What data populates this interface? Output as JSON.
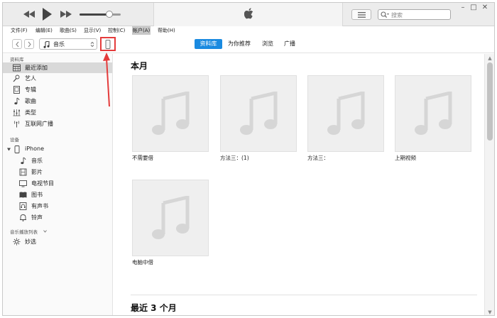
{
  "menu": [
    "文件(F)",
    "编辑(E)",
    "歌曲(S)",
    "显示(V)",
    "控制(C)",
    "帐户(A)",
    "帮助(H)"
  ],
  "menu_active_index": 5,
  "search": {
    "placeholder": "搜索"
  },
  "toolbar": {
    "media_select": "音乐"
  },
  "tabs": [
    "资料库",
    "为你推荐",
    "浏览",
    "广播"
  ],
  "tab_active_index": 0,
  "sidebar": {
    "library_header": "资料库",
    "library_items": [
      {
        "label": "最近添加",
        "icon": "recently-added-icon",
        "selected": true
      },
      {
        "label": "艺人",
        "icon": "artist-icon",
        "selected": false
      },
      {
        "label": "专辑",
        "icon": "album-icon",
        "selected": false
      },
      {
        "label": "歌曲",
        "icon": "song-icon",
        "selected": false
      },
      {
        "label": "类型",
        "icon": "genre-icon",
        "selected": false
      },
      {
        "label": "互联网广播",
        "icon": "internet-radio-icon",
        "selected": false
      }
    ],
    "devices_header": "设备",
    "device": {
      "name": "iPhone"
    },
    "device_items": [
      {
        "label": "音乐",
        "icon": "music-icon"
      },
      {
        "label": "影片",
        "icon": "film-icon"
      },
      {
        "label": "电视节目",
        "icon": "tv-icon"
      },
      {
        "label": "图书",
        "icon": "book-icon"
      },
      {
        "label": "有声书",
        "icon": "audiobook-icon"
      },
      {
        "label": "铃声",
        "icon": "bell-icon"
      }
    ],
    "playlists_header": "音乐播放列表",
    "playlist_items": [
      {
        "label": "妙选",
        "icon": "genius-icon"
      }
    ]
  },
  "main": {
    "section_this_month": "本月",
    "albums_row1": [
      "不需要借",
      "方法三：(1)",
      "方法三：",
      "上期视频"
    ],
    "albums_row2": [
      "电脑中借"
    ],
    "section_recent": "最近 3 个月"
  },
  "colors": {
    "accent_blue": "#1a8ae0",
    "annotation_red": "#e43b3b",
    "selected_row": "#d9d9d9"
  },
  "volume_level": 0.72
}
